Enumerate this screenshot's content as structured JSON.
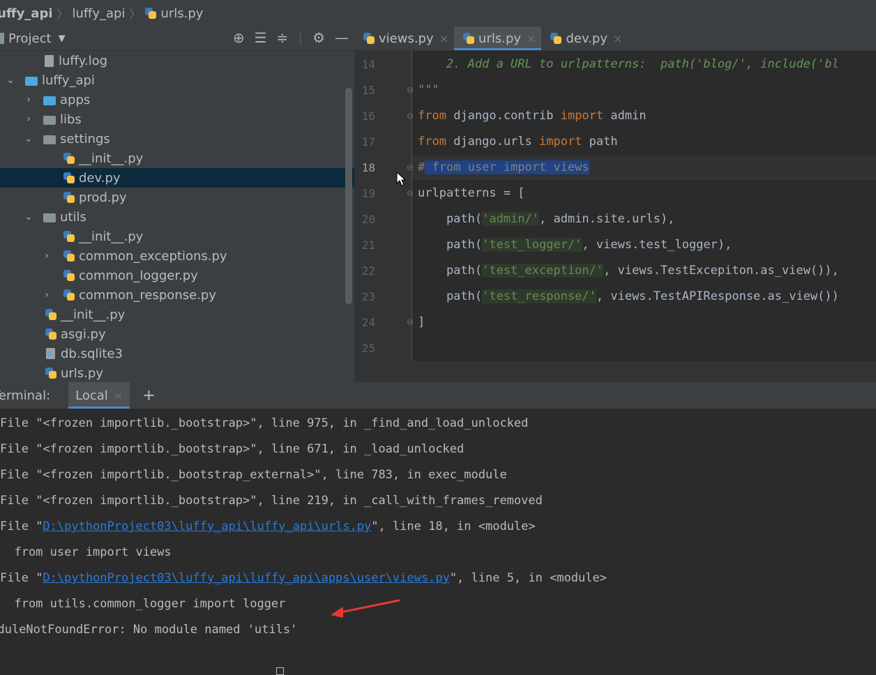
{
  "breadcrumb": [
    "luffy_api",
    "luffy_api",
    "urls.py"
  ],
  "project": {
    "title": "Project",
    "dropdown_icon": "triangle-down-icon",
    "tools": [
      "crosshair-icon",
      "expand-all-icon",
      "collapse-all-icon",
      "gear-icon",
      "minimize-icon"
    ],
    "tree": [
      {
        "label": "luffy.log",
        "type": "file",
        "depth": 2
      },
      {
        "label": "luffy_api",
        "type": "folder-blue",
        "depth": 1,
        "expanded": true
      },
      {
        "label": "apps",
        "type": "folder-blue",
        "depth": 2,
        "expanded": false
      },
      {
        "label": "libs",
        "type": "folder",
        "depth": 2,
        "expanded": false
      },
      {
        "label": "settings",
        "type": "folder",
        "depth": 2,
        "expanded": true
      },
      {
        "label": "__init__.py",
        "type": "py",
        "depth": 3
      },
      {
        "label": "dev.py",
        "type": "py",
        "depth": 3,
        "selected": true
      },
      {
        "label": "prod.py",
        "type": "py",
        "depth": 3
      },
      {
        "label": "utils",
        "type": "folder",
        "depth": 2,
        "expanded": true
      },
      {
        "label": "__init__.py",
        "type": "py",
        "depth": 3
      },
      {
        "label": "common_exceptions.py",
        "type": "py",
        "depth": 3,
        "expanded": false
      },
      {
        "label": "common_logger.py",
        "type": "py",
        "depth": 3
      },
      {
        "label": "common_response.py",
        "type": "py",
        "depth": 3,
        "expanded": false
      },
      {
        "label": "__init__.py",
        "type": "py",
        "depth": 2
      },
      {
        "label": "asgi.py",
        "type": "py",
        "depth": 2
      },
      {
        "label": "db.sqlite3",
        "type": "db",
        "depth": 2
      },
      {
        "label": "urls.py",
        "type": "py",
        "depth": 2
      }
    ]
  },
  "editor": {
    "tabs": [
      {
        "label": "views.py",
        "active": false
      },
      {
        "label": "urls.py",
        "active": true
      },
      {
        "label": "dev.py",
        "active": false
      }
    ],
    "line_numbers": [
      "14",
      "15",
      "16",
      "17",
      "18",
      "19",
      "20",
      "21",
      "22",
      "23",
      "24",
      "25"
    ],
    "current_line": "18",
    "code": {
      "l14": "    2. Add a URL to urlpatterns:  path('blog/', include('bl",
      "l15": "\"\"\"",
      "l16_kw1": "from",
      "l16_mod": " django.contrib ",
      "l16_kw2": "import",
      "l16_name": " admin",
      "l17_kw1": "from",
      "l17_mod": " django.urls ",
      "l17_kw2": "import",
      "l17_name": " path",
      "l18_hash": "#",
      "l18_sel": " from user import views",
      "l19": "urlpatterns = [",
      "l20_a": "    path(",
      "l20_s": "'admin/'",
      "l20_b": ", admin.site.urls),",
      "l21_a": "    path(",
      "l21_s": "'test_logger/'",
      "l21_b": ", views.test_logger),",
      "l22_a": "    path(",
      "l22_s": "'test_exception/'",
      "l22_b": ", views.TestExcepiton.as_view()),",
      "l23_a": "    path(",
      "l23_s": "'test_response/'",
      "l23_b": ", views.TestAPIResponse.as_view())",
      "l24": "]"
    }
  },
  "terminal": {
    "label": "Terminal:",
    "tab": "Local",
    "add": "+",
    "lines": {
      "t1": "File \"<frozen importlib._bootstrap>\", line 975, in _find_and_load_unlocked",
      "t2": "File \"<frozen importlib._bootstrap>\", line 671, in _load_unlocked",
      "t3": "File \"<frozen importlib._bootstrap_external>\", line 783, in exec_module",
      "t4": "File \"<frozen importlib._bootstrap>\", line 219, in _call_with_frames_removed",
      "t5_pre": "File \"",
      "t5_link": "D:\\pythonProject03\\luffy_api\\luffy_api\\urls.py",
      "t5_post": "\", line 18, in <module>",
      "t6": "  from user import views",
      "t7_pre": "File \"",
      "t7_link": "D:\\pythonProject03\\luffy_api\\luffy_api\\apps\\user\\views.py",
      "t7_post": "\", line 5, in <module>",
      "t8": "  from utils.common_logger import logger",
      "t9": "ModuleNotFoundError: No module named 'utils'"
    }
  },
  "annotation": {
    "arrow_color": "#e53935"
  }
}
